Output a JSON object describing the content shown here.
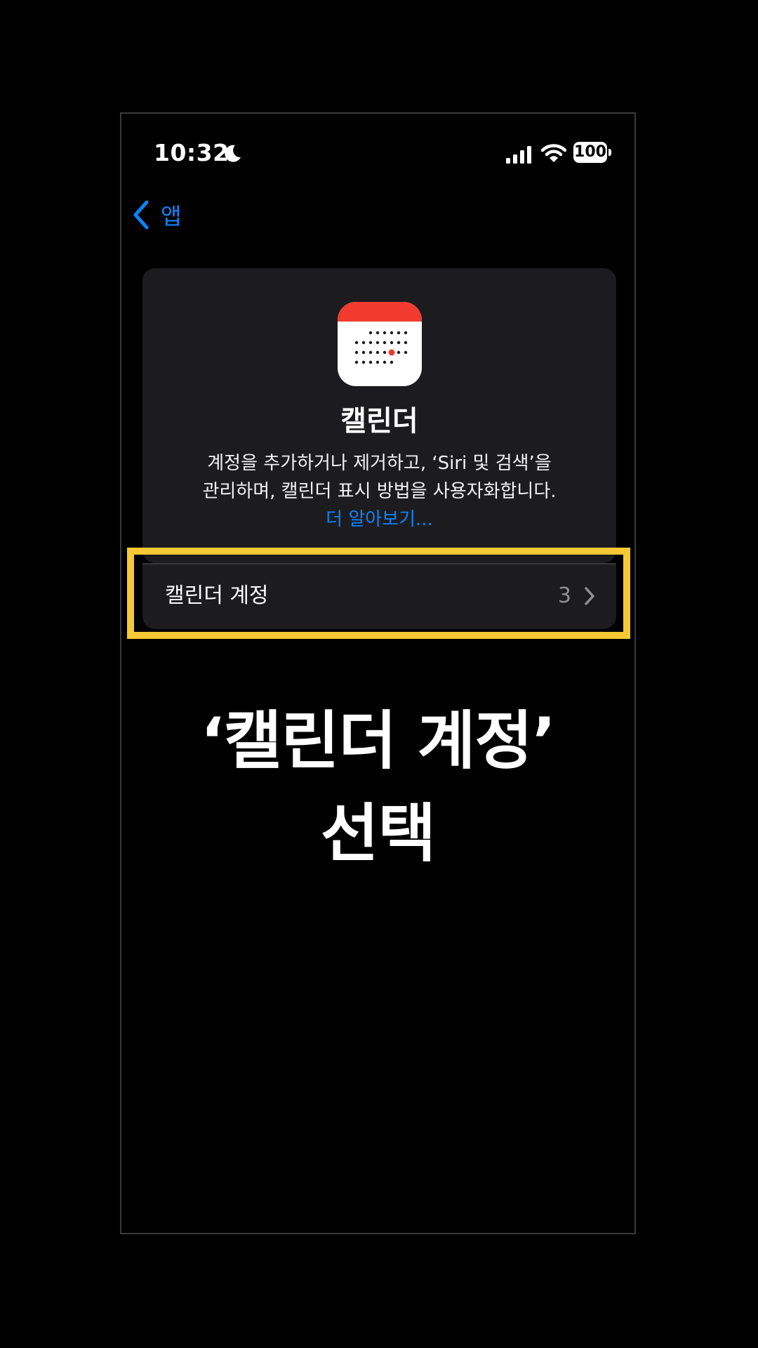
{
  "status_bar": {
    "time": "10:32",
    "battery_level": "100",
    "icons": [
      "moon-icon",
      "signal-icon",
      "wifi-icon",
      "battery-icon"
    ]
  },
  "nav": {
    "back_label": "앱",
    "back_icon": "chevron-left-icon"
  },
  "app_card": {
    "icon": "calendar-app-icon",
    "title": "캘린더",
    "description_line1": "계정을 추가하거나 제거하고, ‘Siri 및 검색’을",
    "description_line2": "관리하며, 캘린더 표시 방법을 사용자화합니다.",
    "learn_more": "더 알아보기..."
  },
  "accounts_row": {
    "label": "캘린더 계정",
    "count": "3"
  },
  "caption": {
    "line1": "‘캘린더 계정’",
    "line2": "선택"
  },
  "colors": {
    "background": "#000000",
    "card": "#1c1c1e",
    "accent_blue": "#0a84ff",
    "highlight": "#f6c834",
    "calendar_red": "#f23b2f"
  }
}
